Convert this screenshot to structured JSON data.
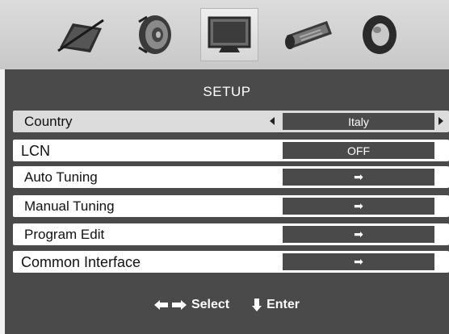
{
  "icons": [
    {
      "name": "picture-icon",
      "selected": false
    },
    {
      "name": "sound-icon",
      "selected": false
    },
    {
      "name": "setup-tv-icon",
      "selected": true
    },
    {
      "name": "timer-icon",
      "selected": false
    },
    {
      "name": "option-icon",
      "selected": false
    }
  ],
  "menu": {
    "title": "SETUP",
    "rows": [
      {
        "label": "Country",
        "value": "Italy"
      },
      {
        "label": "LCN",
        "value": "OFF"
      },
      {
        "label": "Auto Tuning",
        "value": "➡"
      },
      {
        "label": "Manual Tuning",
        "value": "➡"
      },
      {
        "label": "Program Edit",
        "value": "➡"
      },
      {
        "label": "Common Interface",
        "value": "➡"
      }
    ],
    "selected_row": "Country"
  },
  "footer": {
    "select_label": "Select",
    "enter_label": "Enter"
  },
  "colors": {
    "panel": "#4a4a4a",
    "row": "#ffffff",
    "selected_row": "#dcdcdc"
  }
}
